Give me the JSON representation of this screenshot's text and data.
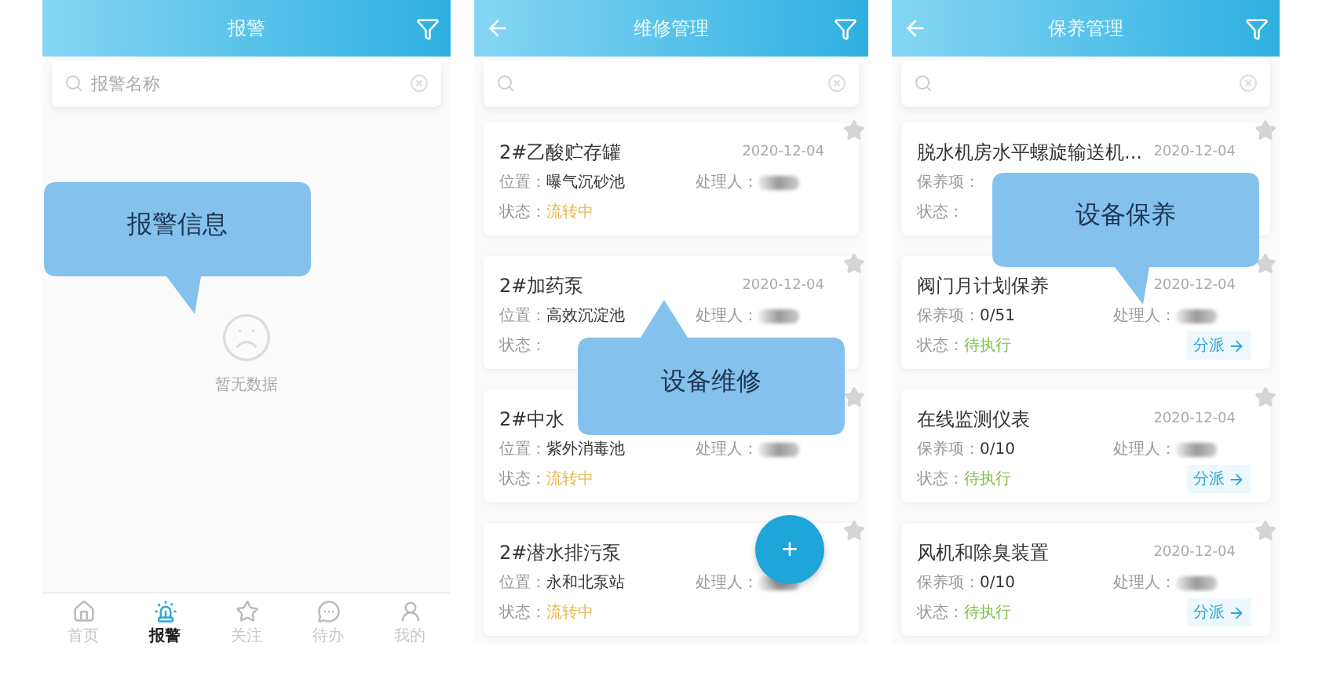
{
  "panels": [
    {
      "kind": "alarm",
      "title": "报警",
      "search": {
        "placeholder": "报警名称"
      },
      "empty": {
        "text": "暂无数据"
      },
      "callout": "报警信息",
      "nav": [
        {
          "label": "首页",
          "selected": false
        },
        {
          "label": "报警",
          "selected": true
        },
        {
          "label": "关注",
          "selected": false
        },
        {
          "label": "待办",
          "selected": false
        },
        {
          "label": "我的",
          "selected": false
        }
      ]
    },
    {
      "kind": "repair",
      "title": "维修管理",
      "callout": "设备维修",
      "fab": "+",
      "cards": [
        {
          "title": "2#乙酸贮存罐",
          "date": "2020-12-04",
          "field": {
            "label": "位置：",
            "value": "曝气沉砂池"
          },
          "handler_label": "处理人：",
          "status": {
            "label": "状态：",
            "value": "流转中",
            "color": "#e6b84a"
          }
        },
        {
          "title": "2#加药泵",
          "date": "2020-12-04",
          "field": {
            "label": "位置：",
            "value": "高效沉淀池"
          },
          "handler_label": "处理人：",
          "status": {
            "label": "状态："
          }
        },
        {
          "title": "2#中水",
          "field": {
            "label": "位置：",
            "value": "紫外消毒池"
          },
          "handler_label": "处理人：",
          "status": {
            "label": "状态：",
            "value": "流转中",
            "color": "#e6b84a"
          }
        },
        {
          "title": "2#潜水排污泵",
          "field": {
            "label": "位置：",
            "value": "永和北泵站"
          },
          "handler_label": "处理人：",
          "status": {
            "label": "状态：",
            "value": "流转中",
            "color": "#e6b84a"
          }
        }
      ]
    },
    {
      "kind": "maintenance",
      "title": "保养管理",
      "callout": "设备保养",
      "cards": [
        {
          "title": "脱水机房水平螺旋输送机...",
          "date": "2020-12-04",
          "field": {
            "label": "保养项："
          },
          "status": {
            "label": "状态："
          }
        },
        {
          "title": "阀门月计划保养",
          "date": "2020-12-04",
          "field": {
            "label": "保养项：",
            "value": "0/51"
          },
          "handler_label": "处理人：",
          "status": {
            "label": "状态：",
            "value": "待执行",
            "color": "#7cbf45"
          },
          "action": "分派"
        },
        {
          "title": "在线监测仪表",
          "date": "2020-12-04",
          "field": {
            "label": "保养项：",
            "value": "0/10"
          },
          "handler_label": "处理人：",
          "status": {
            "label": "状态：",
            "value": "待执行",
            "color": "#7cbf45"
          },
          "action": "分派"
        },
        {
          "title": "风机和除臭装置",
          "date": "2020-12-04",
          "field": {
            "label": "保养项：",
            "value": "0/10"
          },
          "handler_label": "处理人：",
          "status": {
            "label": "状态：",
            "value": "待执行",
            "color": "#7cbf45"
          },
          "action": "分派"
        }
      ]
    }
  ]
}
